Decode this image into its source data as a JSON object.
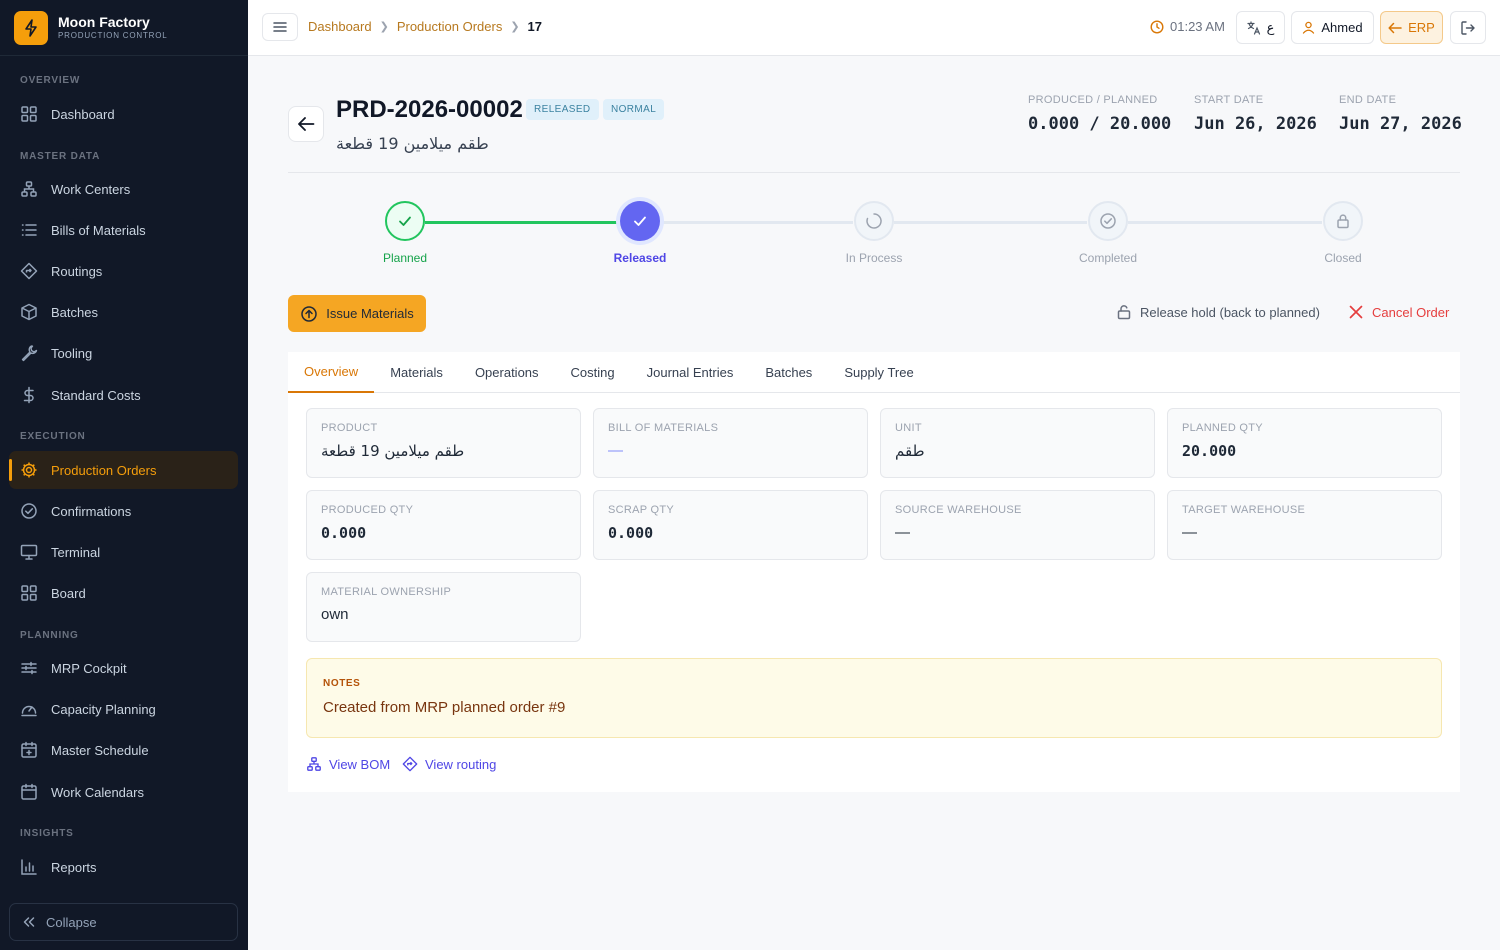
{
  "brand": {
    "name": "Moon Factory",
    "subtitle": "PRODUCTION CONTROL"
  },
  "sidebar": {
    "sections": {
      "overview": "OVERVIEW",
      "master_data": "MASTER DATA",
      "execution": "EXECUTION",
      "planning": "PLANNING",
      "insights": "INSIGHTS"
    },
    "items": {
      "dashboard": "Dashboard",
      "work_centers": "Work Centers",
      "bom": "Bills of Materials",
      "routings": "Routings",
      "batches": "Batches",
      "tooling": "Tooling",
      "standard_costs": "Standard Costs",
      "production_orders": "Production Orders",
      "confirmations": "Confirmations",
      "terminal": "Terminal",
      "board": "Board",
      "mrp_cockpit": "MRP Cockpit",
      "capacity_planning": "Capacity Planning",
      "master_schedule": "Master Schedule",
      "work_calendars": "Work Calendars",
      "reports": "Reports"
    },
    "collapse_label": "Collapse",
    "active_item": "production_orders"
  },
  "topbar": {
    "breadcrumb": [
      "Dashboard",
      "Production Orders",
      "17"
    ],
    "time": "01:23 AM",
    "language_label": "ع",
    "user_name": "Ahmed",
    "erp_label": "ERP"
  },
  "order": {
    "number": "PRD-2026-00002",
    "status_badge": "RELEASED",
    "priority_badge": "NORMAL",
    "name": "طقم ميلامين 19 قطعة",
    "stats": {
      "produced_planned_label": "PRODUCED / PLANNED",
      "produced_planned_value": "0.000 / 20.000",
      "start_label": "START DATE",
      "start_value": "Jun 26, 2026",
      "end_label": "END DATE",
      "end_value": "Jun 27, 2026"
    }
  },
  "stepper": {
    "steps": [
      "Planned",
      "Released",
      "In Process",
      "Completed",
      "Closed"
    ],
    "current_index": 1
  },
  "actions": {
    "issue_materials": "Issue Materials",
    "release_hold": "Release hold (back to planned)",
    "cancel_order": "Cancel Order"
  },
  "tabs": [
    "Overview",
    "Materials",
    "Operations",
    "Costing",
    "Journal Entries",
    "Batches",
    "Supply Tree"
  ],
  "overview": {
    "product_label": "PRODUCT",
    "product_value": "طقم ميلامين 19 قطعة",
    "bom_label": "BILL OF MATERIALS",
    "bom_value": "—",
    "unit_label": "UNIT",
    "unit_value": "طقم",
    "planned_qty_label": "PLANNED QTY",
    "planned_qty_value": "20.000",
    "produced_qty_label": "PRODUCED QTY",
    "produced_qty_value": "0.000",
    "scrap_qty_label": "SCRAP QTY",
    "scrap_qty_value": "0.000",
    "source_wh_label": "SOURCE WAREHOUSE",
    "source_wh_value": "—",
    "target_wh_label": "TARGET WAREHOUSE",
    "target_wh_value": "—",
    "ownership_label": "MATERIAL OWNERSHIP",
    "ownership_value": "own",
    "notes_label": "NOTES",
    "notes_text": "Created from MRP planned order #9",
    "view_bom": "View BOM",
    "view_routing": "View routing"
  },
  "colors": {
    "accent": "#f59e0b",
    "sidebar_bg": "#111827",
    "step_done": "#22c55e",
    "step_current": "#6366f1",
    "danger": "#e53e3e",
    "link": "#4f46e5"
  }
}
